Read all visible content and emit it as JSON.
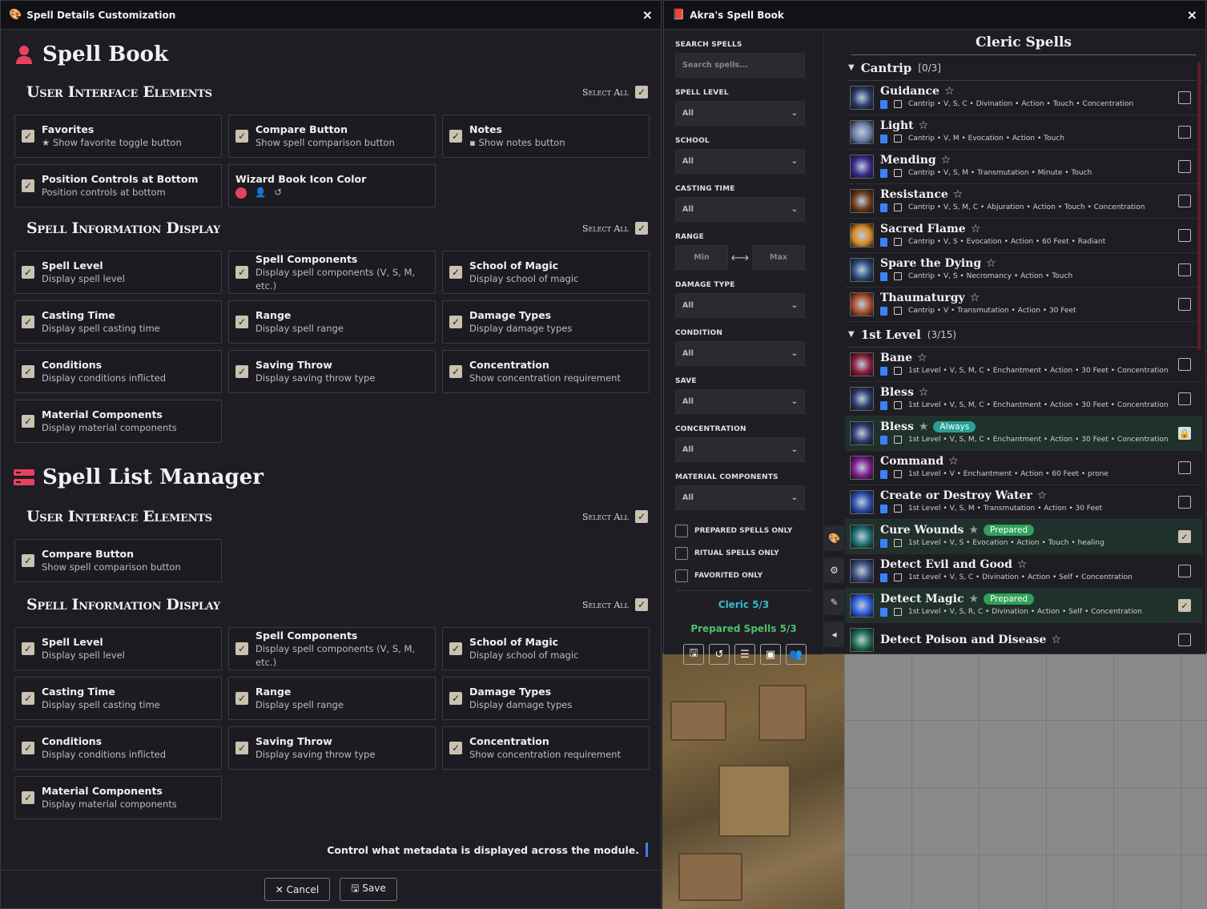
{
  "left_window": {
    "title": "Spell Details Customization",
    "close": "×",
    "spell_book": {
      "title": "Spell Book",
      "ui_group": {
        "title": "User Interface Elements",
        "select_all": "Select All",
        "cards": [
          {
            "title": "Favorites",
            "desc": "★ Show favorite toggle button"
          },
          {
            "title": "Compare Button",
            "desc": "Show spell comparison button"
          },
          {
            "title": "Notes",
            "desc": "▪ Show notes button"
          },
          {
            "title": "Position Controls at Bottom",
            "desc": "Position controls at bottom"
          },
          {
            "title": "Wizard Book Icon Color",
            "desc": ""
          }
        ]
      },
      "info_group": {
        "title": "Spell Information Display",
        "select_all": "Select All",
        "cards": [
          {
            "title": "Spell Level",
            "desc": "Display spell level"
          },
          {
            "title": "Spell Components",
            "desc": "Display spell components (V, S, M, etc.)"
          },
          {
            "title": "School of Magic",
            "desc": "Display school of magic"
          },
          {
            "title": "Casting Time",
            "desc": "Display spell casting time"
          },
          {
            "title": "Range",
            "desc": "Display spell range"
          },
          {
            "title": "Damage Types",
            "desc": "Display damage types"
          },
          {
            "title": "Conditions",
            "desc": "Display conditions inflicted"
          },
          {
            "title": "Saving Throw",
            "desc": "Display saving throw type"
          },
          {
            "title": "Concentration",
            "desc": "Show concentration requirement"
          },
          {
            "title": "Material Components",
            "desc": "Display material components"
          }
        ]
      }
    },
    "list_manager": {
      "title": "Spell List Manager",
      "ui_group": {
        "title": "User Interface Elements",
        "select_all": "Select All",
        "cards": [
          {
            "title": "Compare Button",
            "desc": "Show spell comparison button"
          }
        ]
      },
      "info_group": {
        "title": "Spell Information Display",
        "select_all": "Select All",
        "cards": [
          {
            "title": "Spell Level",
            "desc": "Display spell level"
          },
          {
            "title": "Spell Components",
            "desc": "Display spell components (V, S, M, etc.)"
          },
          {
            "title": "School of Magic",
            "desc": "Display school of magic"
          },
          {
            "title": "Casting Time",
            "desc": "Display spell casting time"
          },
          {
            "title": "Range",
            "desc": "Display spell range"
          },
          {
            "title": "Damage Types",
            "desc": "Display damage types"
          },
          {
            "title": "Conditions",
            "desc": "Display conditions inflicted"
          },
          {
            "title": "Saving Throw",
            "desc": "Display saving throw type"
          },
          {
            "title": "Concentration",
            "desc": "Show concentration requirement"
          },
          {
            "title": "Material Components",
            "desc": "Display material components"
          }
        ]
      }
    },
    "footer_note": "Control what metadata is displayed across the module.",
    "cancel": "✕ Cancel",
    "save": "🖫 Save",
    "accent_color": "#e8415f"
  },
  "right_window": {
    "title": "Akra's Spell Book",
    "close": "×",
    "filters": {
      "search_label": "SEARCH SPELLS",
      "search_placeholder": "Search spells...",
      "spell_level_label": "SPELL LEVEL",
      "spell_level_value": "All",
      "school_label": "SCHOOL",
      "school_value": "All",
      "casting_time_label": "CASTING TIME",
      "casting_time_value": "All",
      "range_label": "RANGE",
      "range_min": "Min",
      "range_max": "Max",
      "damage_type_label": "DAMAGE TYPE",
      "damage_type_value": "All",
      "condition_label": "CONDITION",
      "condition_value": "All",
      "save_label": "SAVE",
      "save_value": "All",
      "concentration_label": "CONCENTRATION",
      "concentration_value": "All",
      "material_label": "MATERIAL COMPONENTS",
      "material_value": "All",
      "prepared_only": "PREPARED SPELLS ONLY",
      "ritual_only": "RITUAL SPELLS ONLY",
      "favorited_only": "FAVORITED ONLY",
      "class_count": "Cleric 5/3",
      "prepared_count": "Prepared Spells 5/3"
    },
    "list_title": "Cleric Spells",
    "cantrip": {
      "name": "Cantrip",
      "count": "[0/3]"
    },
    "level1": {
      "name": "1st Level",
      "count": "(3/15)"
    },
    "cantrips": [
      {
        "name": "Guidance",
        "meta": "Cantrip • V, S, C • Divination • Action • Touch • Concentration",
        "color": "#2a3a6a"
      },
      {
        "name": "Light",
        "meta": "Cantrip • V, M • Evocation • Action • Touch",
        "color": "#6a7aa8"
      },
      {
        "name": "Mending",
        "meta": "Cantrip • V, S, M • Transmutation • Minute • Touch",
        "color": "#3a2a8a"
      },
      {
        "name": "Resistance",
        "meta": "Cantrip • V, S, M, C • Abjuration • Action • Touch • Concentration",
        "color": "#6a3a1a"
      },
      {
        "name": "Sacred Flame",
        "meta": "Cantrip • V, S • Evocation • Action • 60 Feet • Radiant",
        "color": "#d88a20"
      },
      {
        "name": "Spare the Dying",
        "meta": "Cantrip • V, S • Necromancy • Action • Touch",
        "color": "#2a4a7a"
      },
      {
        "name": "Thaumaturgy",
        "meta": "Cantrip • V • Transmutation • Action • 30 Feet",
        "color": "#a84a2a"
      }
    ],
    "level1_spells": [
      {
        "name": "Bane",
        "meta": "1st Level • V, S, M, C • Enchantment • Action • 30 Feet • Concentration",
        "color": "#8a1a3a"
      },
      {
        "name": "Bless",
        "meta": "1st Level • V, S, M, C • Enchantment • Action • 30 Feet • Concentration",
        "color": "#2a3a6a"
      },
      {
        "name": "Bless",
        "meta": "1st Level • V, S, M, C • Enchantment • Action • 30 Feet • Concentration",
        "badge": "Always",
        "color": "#2a3a6a"
      },
      {
        "name": "Command",
        "meta": "1st Level • V • Enchantment • Action • 60 Feet • prone",
        "color": "#7a1a8a"
      },
      {
        "name": "Create or Destroy Water",
        "meta": "1st Level • V, S, M • Transmutation • Action • 30 Feet",
        "color": "#2a4aa8"
      },
      {
        "name": "Cure Wounds",
        "meta": "1st Level • V, S • Evocation • Action • Touch • healing",
        "badge": "Prepared",
        "color": "#1a6a6a"
      },
      {
        "name": "Detect Evil and Good",
        "meta": "1st Level • V, S, C • Divination • Action • Self • Concentration",
        "color": "#3a4a7a"
      },
      {
        "name": "Detect Magic",
        "meta": "1st Level • V, S, R, C • Divination • Action • Self • Concentration",
        "badge": "Prepared",
        "color": "#2a5ad8"
      },
      {
        "name": "Detect Poison and Disease",
        "meta": "",
        "color": "#1a6a4a"
      }
    ]
  }
}
